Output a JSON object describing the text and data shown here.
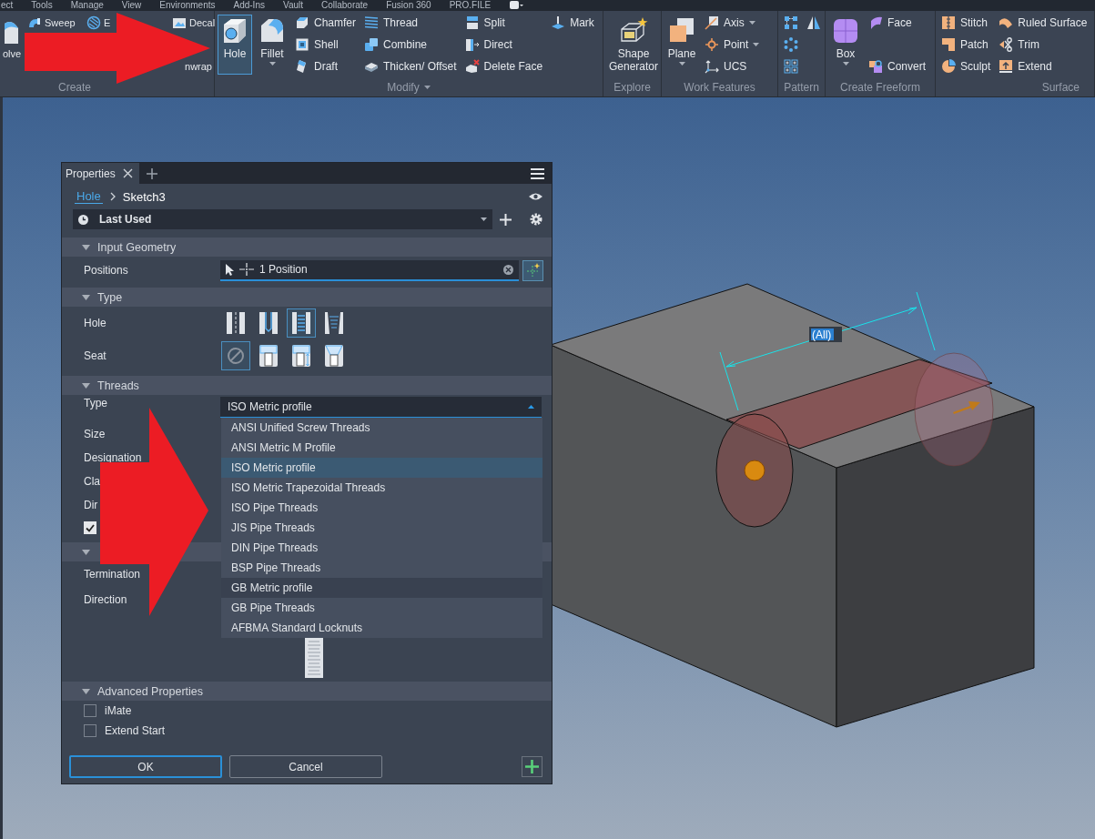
{
  "menu_bar": [
    "ect",
    "Tools",
    "Manage",
    "View",
    "Environments",
    "Add-Ins",
    "Vault",
    "Collaborate",
    "Fusion 360",
    "PRO.FILE"
  ],
  "ribbon": {
    "panels": [
      {
        "label": "Create",
        "columns": [
          [
            {
              "kind": "large",
              "label": "olve"
            }
          ],
          [
            {
              "kind": "small",
              "label": "Sweep"
            }
          ],
          [
            {
              "kind": "small",
              "label": "E"
            }
          ],
          [
            {
              "kind": "small",
              "label": "Decal"
            },
            {
              "kind": "small",
              "label": "nwrap"
            }
          ]
        ]
      },
      {
        "label": "Modify",
        "menu": true,
        "columns": [
          [
            {
              "kind": "large",
              "label": "Hole",
              "active": true,
              "menu": false
            }
          ],
          [
            {
              "kind": "large",
              "label": "Fillet",
              "active": false,
              "menu": true
            }
          ],
          [
            {
              "kind": "small",
              "label": "Chamfer"
            },
            {
              "kind": "small",
              "label": "Shell"
            },
            {
              "kind": "small",
              "label": "Draft"
            }
          ],
          [
            {
              "kind": "small",
              "label": "Thread"
            },
            {
              "kind": "small",
              "label": "Combine"
            },
            {
              "kind": "small",
              "label": "Thicken/ Offset"
            }
          ],
          [
            {
              "kind": "small",
              "label": "Split"
            },
            {
              "kind": "small",
              "label": "Direct"
            },
            {
              "kind": "small",
              "label": "Delete Face"
            }
          ],
          [
            {
              "kind": "small",
              "label": "Mark"
            }
          ]
        ]
      },
      {
        "label": "Explore",
        "columns": [
          [
            {
              "kind": "large",
              "label": "Shape Generator",
              "active": false,
              "menu": false
            }
          ]
        ]
      },
      {
        "label": "Work Features",
        "columns": [
          [
            {
              "kind": "large",
              "label": "Plane",
              "active": false,
              "menu": true
            }
          ],
          [
            {
              "kind": "small",
              "label": "Axis",
              "menu": true
            },
            {
              "kind": "small",
              "label": "Point",
              "menu": true
            },
            {
              "kind": "small",
              "label": "UCS",
              "menu": false
            }
          ]
        ]
      },
      {
        "label": "Pattern",
        "columns": [
          [
            {
              "kind": "icon"
            },
            {
              "kind": "icon"
            },
            {
              "kind": "icon"
            }
          ],
          [
            {
              "kind": "icon"
            }
          ]
        ]
      },
      {
        "label": "Create Freeform",
        "columns": [
          [
            {
              "kind": "large",
              "label": "Box",
              "active": false,
              "menu": true
            }
          ],
          [
            {
              "kind": "small",
              "label": "Face"
            },
            {
              "kind": "small",
              "label": "Convert"
            }
          ]
        ]
      },
      {
        "label": "Surface",
        "columns": [
          [
            {
              "kind": "small",
              "label": "Stitch"
            },
            {
              "kind": "small",
              "label": "Patch"
            },
            {
              "kind": "small",
              "label": "Sculpt"
            }
          ],
          [
            {
              "kind": "small",
              "label": "Ruled Surface"
            },
            {
              "kind": "small",
              "label": "Trim"
            },
            {
              "kind": "small",
              "label": "Extend"
            }
          ]
        ]
      }
    ]
  },
  "properties_panel": {
    "tab": {
      "label": "Properties"
    },
    "breadcrumb": [
      {
        "kind": "link",
        "label": "Hole"
      },
      {
        "kind": "text",
        "label": "Sketch3"
      }
    ],
    "preset": {
      "value": "Last Used"
    },
    "sections": [
      {
        "title": "Input Geometry",
        "expanded": true,
        "rows": [
          {
            "kind": "selector",
            "label": "Positions",
            "value": "1 Position"
          }
        ]
      },
      {
        "title": "Type",
        "expanded": true,
        "rows": [
          {
            "kind": "icons",
            "label": "Hole",
            "options": [
              {
                "selected": false
              },
              {
                "selected": false
              },
              {
                "selected": true
              },
              {
                "selected": false
              }
            ]
          },
          {
            "kind": "icons",
            "label": "Seat",
            "options": [
              {
                "selected": true
              },
              {
                "selected": false
              },
              {
                "selected": false
              },
              {
                "selected": false
              }
            ]
          }
        ]
      },
      {
        "title": "Threads",
        "expanded": true,
        "rows": [
          {
            "kind": "dropdown",
            "label": "Type",
            "value": "ISO Metric profile",
            "open": true,
            "options": [
              {
                "label": "ANSI Unified Screw Threads",
                "selected": false,
                "hovered": false
              },
              {
                "label": "ANSI Metric M Profile",
                "selected": false,
                "hovered": false
              },
              {
                "label": "ISO Metric profile",
                "selected": true,
                "hovered": false
              },
              {
                "label": "ISO Metric Trapezoidal Threads",
                "selected": false,
                "hovered": false
              },
              {
                "label": "ISO Pipe Threads",
                "selected": false,
                "hovered": false
              },
              {
                "label": "JIS Pipe Threads",
                "selected": false,
                "hovered": false
              },
              {
                "label": "DIN Pipe Threads",
                "selected": false,
                "hovered": false
              },
              {
                "label": "BSP Pipe Threads",
                "selected": false,
                "hovered": false
              },
              {
                "label": "GB Metric profile",
                "selected": false,
                "hovered": true
              },
              {
                "label": "GB Pipe Threads",
                "selected": false,
                "hovered": false
              },
              {
                "label": "AFBMA Standard Locknuts",
                "selected": false,
                "hovered": false
              }
            ]
          },
          {
            "kind": "label",
            "label": "Size"
          },
          {
            "kind": "label",
            "label": "Designation"
          },
          {
            "kind": "label",
            "label": "Cla"
          },
          {
            "kind": "label",
            "label": "Dir"
          },
          {
            "kind": "checkbox",
            "checked": true
          }
        ]
      },
      {
        "expanded": true,
        "rows": [
          {
            "kind": "label",
            "label": "Termination"
          },
          {
            "kind": "label",
            "label": "Direction"
          },
          {
            "kind": "preview"
          }
        ]
      },
      {
        "title": "Advanced Properties",
        "expanded": true,
        "rows": [
          {
            "kind": "checkbox",
            "label": "iMate",
            "checked": false
          },
          {
            "kind": "checkbox",
            "label": "Extend Start",
            "checked": false
          }
        ]
      }
    ],
    "buttons": [
      {
        "label": "OK",
        "focused": true
      },
      {
        "label": "Cancel",
        "focused": false
      }
    ]
  },
  "viewport": {
    "dimension_label": "(All)"
  }
}
